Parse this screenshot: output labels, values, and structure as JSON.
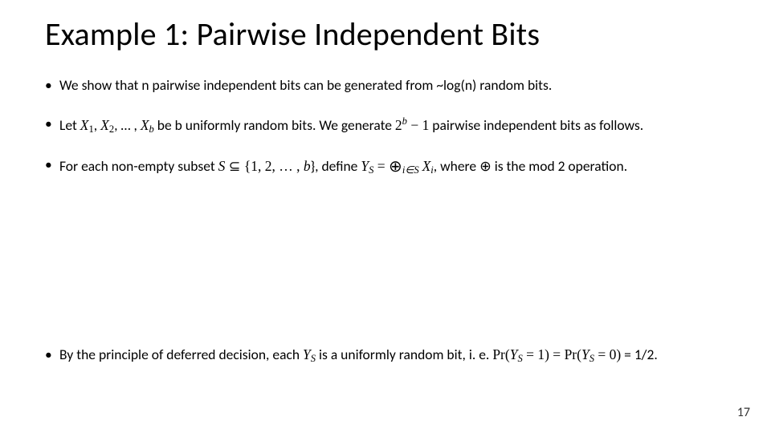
{
  "title": "Example 1: Pairwise Independent Bits",
  "bullets": {
    "b1": {
      "t1": "We show that n pairwise independent bits can be generated from ~log(n) random bits."
    },
    "b2": {
      "t1": "Let ",
      "x_vars": "X",
      "sub1": "1",
      "comma1": ", ",
      "sub2": "2",
      "dots": ", … , ",
      "subb": "b",
      "t2": " be b uniformly random bits.   We generate ",
      "two": "2",
      "supb": "b",
      "minus_one": " − 1",
      "t3": " pairwise independent bits as follows."
    },
    "b3": {
      "t1": "For each non-empty subset ",
      "S": "S",
      "subset": " ⊆ {1, 2, … , ",
      "b": "b",
      "close": "}, define ",
      "Y": "Y",
      "subS": "S",
      "eq": " = ",
      "oplus_big": "⊕",
      "sum_sub": "i∈S",
      "space": " ",
      "X": "X",
      "subi": "i",
      "t2": ", where ",
      "oplus2": "⊕",
      "t3": " is the mod 2 operation."
    },
    "b4": {
      "t1": "By the principle of deferred decision, each ",
      "Y": "Y",
      "subS": "S",
      "t2": " is a uniformly random bit, i. e. ",
      "Pr": "Pr",
      "open1": "(",
      "Y2": "Y",
      "subS2": "S",
      "eq1": " = 1) = ",
      "Pr2": "Pr",
      "open2": "(",
      "Y3": "Y",
      "subS3": "S",
      "eq0": " = 0)",
      "tail": " = 1/2."
    }
  },
  "page_number": "17"
}
